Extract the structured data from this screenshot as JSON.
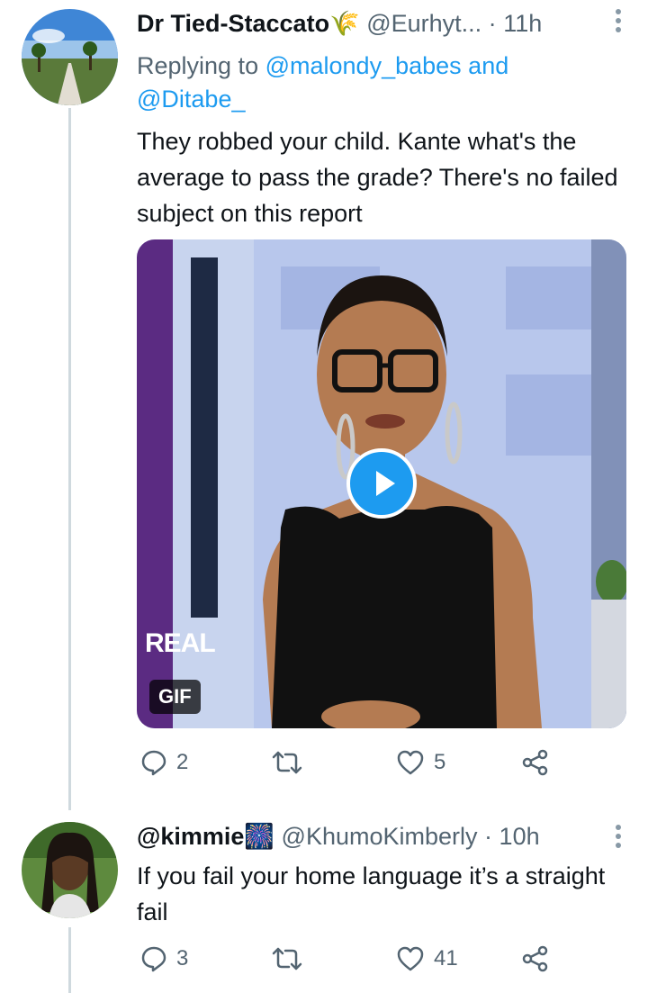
{
  "tweet1": {
    "display_name": "Dr Tied-Staccato",
    "emoji": "🌾",
    "handle": "@Eurhyt...",
    "separator": "·",
    "time": "11h",
    "reply_prefix": "Replying to",
    "reply_mention1": "@malondy_babes",
    "reply_and": "and",
    "reply_mention2": "@Ditabe_",
    "text": "They robbed your child. Kante what's the average to pass the grade? There's no failed subject on this report",
    "media": {
      "badge": "GIF",
      "brand": "REAL"
    },
    "actions": {
      "replies": "2",
      "retweets": "",
      "likes": "5"
    }
  },
  "tweet2": {
    "display_name": "@kimmie",
    "emoji": "🎆",
    "handle": "@KhumoKimberly",
    "separator": "·",
    "time": "10h",
    "text": "If you fail your home language it’s a straight fail",
    "actions": {
      "replies": "3",
      "retweets": "",
      "likes": "41"
    }
  },
  "icons": [
    "reply-icon",
    "retweet-icon",
    "like-icon",
    "share-icon",
    "more-icon",
    "play-icon"
  ],
  "colors": {
    "accent": "#1d9bf0",
    "secondary_text": "#536471",
    "thread_line": "#cfd9de"
  }
}
